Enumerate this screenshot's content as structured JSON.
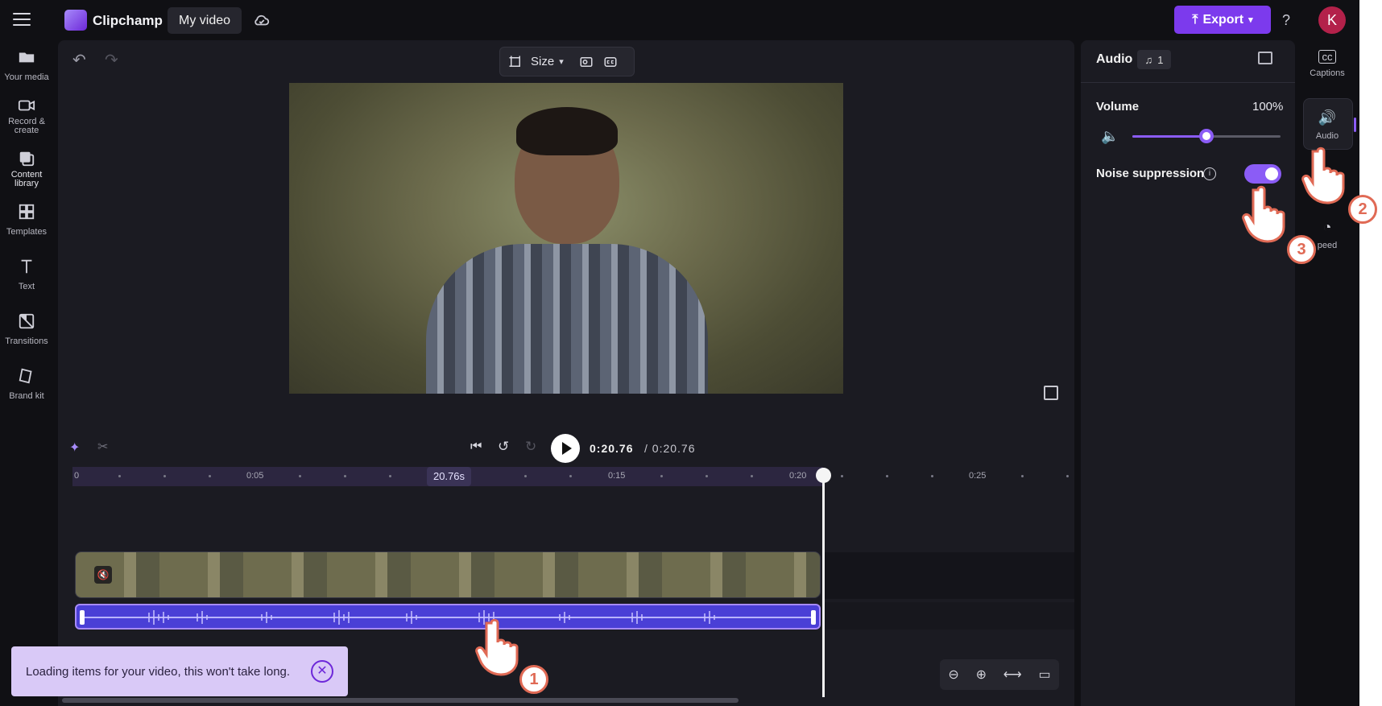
{
  "app": {
    "name": "Clipchamp",
    "project_title": "My video",
    "export_label": "Export",
    "help_label": "?",
    "avatar_initial": "K",
    "accent_color": "#7c3aed"
  },
  "left_sidebar": {
    "items": [
      {
        "label": "Your media",
        "icon": "folder-icon"
      },
      {
        "label": "Record & create",
        "icon": "camera-icon"
      },
      {
        "label": "Content library",
        "icon": "library-icon"
      },
      {
        "label": "Templates",
        "icon": "templates-icon"
      },
      {
        "label": "Text",
        "icon": "text-icon"
      },
      {
        "label": "Transitions",
        "icon": "transitions-icon"
      },
      {
        "label": "Brand kit",
        "icon": "brand-kit-icon"
      }
    ]
  },
  "preview_toolbar": {
    "size_label": "Size"
  },
  "playback": {
    "current_time": "0:20.76",
    "total_time": "/ 0:20.76"
  },
  "timeline": {
    "ticks": [
      "0",
      "0:05",
      "0:15",
      "0:20",
      "0:25"
    ],
    "time_tag": "20.76s",
    "audio_volume_percent": 100
  },
  "toast": {
    "message": "Loading items for your video, this won't take long.",
    "close_symbol": "✕"
  },
  "properties": {
    "title": "Audio",
    "badge_count": "1",
    "volume_label": "Volume",
    "volume_value": "100%",
    "volume_level": 0.5,
    "noise_suppression_label": "Noise suppression",
    "noise_suppression_on": true
  },
  "right_rail": {
    "items": [
      {
        "label": "Captions",
        "icon": "captions-icon"
      },
      {
        "label": "Audio",
        "icon": "speaker-icon"
      },
      {
        "label": "peed",
        "icon": "speed-icon"
      }
    ]
  },
  "annotations": {
    "steps": [
      "1",
      "2",
      "3"
    ]
  }
}
